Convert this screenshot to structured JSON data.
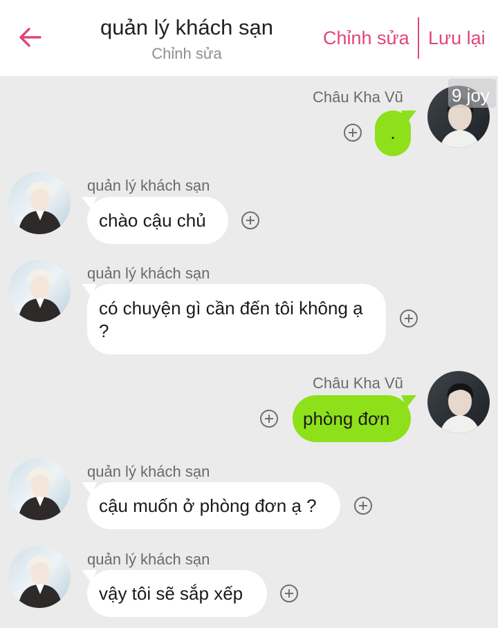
{
  "header": {
    "title": "quản lý khách sạn",
    "subtitle": "Chỉnh sửa",
    "edit_label": "Chỉnh sửa",
    "save_label": "Lưu lại",
    "accent_color": "#e0457a"
  },
  "badge": {
    "text": "9 joy"
  },
  "bubble_colors": {
    "incoming": "#ffffff",
    "outgoing": "#8ee01a",
    "background": "#ebebeb"
  },
  "messages": [
    {
      "side": "right",
      "sender": "Châu Kha Vũ",
      "text": "."
    },
    {
      "side": "left",
      "sender": "quản lý khách sạn",
      "text": "chào cậu chủ"
    },
    {
      "side": "left",
      "sender": "quản lý khách sạn",
      "text": "có chuyện gì cần đến tôi không ạ ?"
    },
    {
      "side": "right",
      "sender": "Châu Kha Vũ",
      "text": "phòng đơn"
    },
    {
      "side": "left",
      "sender": "quản lý khách sạn",
      "text": "cậu muốn ở phòng đơn ạ ?"
    },
    {
      "side": "left",
      "sender": "quản lý khách sạn",
      "text": "vậy tôi sẽ sắp xếp"
    }
  ]
}
